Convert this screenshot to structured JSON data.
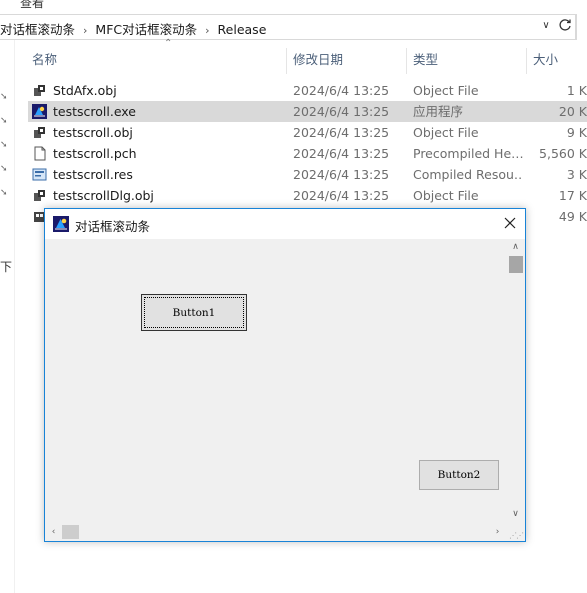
{
  "explorer": {
    "ribbon_cut_text": "查看",
    "breadcrumb": [
      "对话框滚动条",
      "MFC对话框滚动条",
      "Release"
    ],
    "left_cut_text": "下",
    "columns": {
      "name": "名称",
      "date": "修改日期",
      "type": "类型",
      "size": "大小"
    },
    "files": [
      {
        "icon": "obj-file-icon",
        "name": "StdAfx.obj",
        "date": "2024/6/4 13:25",
        "type": "Object File",
        "size": "1 K"
      },
      {
        "icon": "exe-file-icon",
        "name": "testscroll.exe",
        "date": "2024/6/4 13:25",
        "type": "应用程序",
        "size": "20 K"
      },
      {
        "icon": "obj-file-icon",
        "name": "testscroll.obj",
        "date": "2024/6/4 13:25",
        "type": "Object File",
        "size": "9 K"
      },
      {
        "icon": "pch-file-icon",
        "name": "testscroll.pch",
        "date": "2024/6/4 13:25",
        "type": "Precompiled He…",
        "size": "5,560 K"
      },
      {
        "icon": "res-file-icon",
        "name": "testscroll.res",
        "date": "2024/6/4 13:25",
        "type": "Compiled Resou…",
        "size": "3 K"
      },
      {
        "icon": "obj-file-icon",
        "name": "testscrollDlg.obj",
        "date": "2024/6/4 13:25",
        "type": "Object File",
        "size": "17 K"
      },
      {
        "icon": "generic-file-icon",
        "name": "",
        "date": "",
        "type": "",
        "size": "49 K"
      }
    ],
    "selected_index": 1
  },
  "dialog": {
    "title": "对话框滚动条",
    "button1": "Button1",
    "button2": "Button2"
  },
  "colors": {
    "dialog_border": "#1883d7",
    "selection": "#d9d9d9",
    "header_text": "#4c607a"
  }
}
